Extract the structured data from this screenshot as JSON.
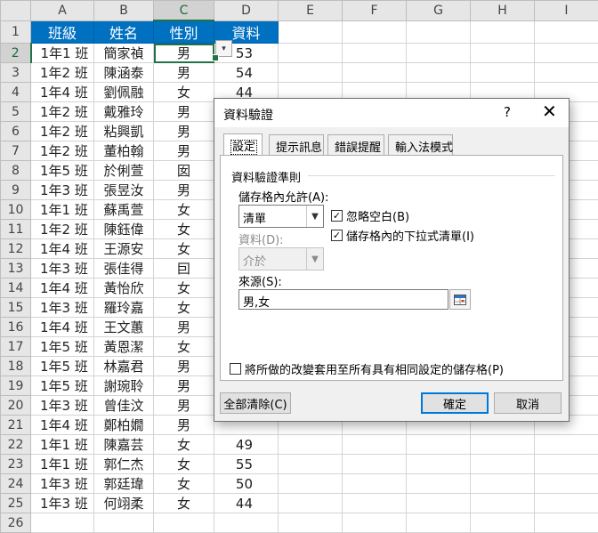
{
  "spreadsheet": {
    "column_headers": [
      "A",
      "B",
      "C",
      "D",
      "E",
      "F",
      "G",
      "H",
      "I"
    ],
    "selected_column": "C",
    "selected_row": 2,
    "header_row": [
      "班級",
      "姓名",
      "性別",
      "資料"
    ],
    "rows": [
      [
        "1年1 班",
        "簡家禎",
        "男",
        "53"
      ],
      [
        "1年2 班",
        "陳涵泰",
        "男",
        "54"
      ],
      [
        "1年4 班",
        "劉佩融",
        "女",
        "44"
      ],
      [
        "1年2 班",
        "戴雅玲",
        "男",
        ""
      ],
      [
        "1年2 班",
        "粘興凱",
        "男",
        ""
      ],
      [
        "1年2 班",
        "董柏翰",
        "男",
        ""
      ],
      [
        "1年5 班",
        "於俐萱",
        "囡",
        ""
      ],
      [
        "1年3 班",
        "張昱汝",
        "男",
        ""
      ],
      [
        "1年1 班",
        "蘇禹萱",
        "女",
        ""
      ],
      [
        "1年2 班",
        "陳鈺偉",
        "女",
        ""
      ],
      [
        "1年4 班",
        "王源安",
        "女",
        ""
      ],
      [
        "1年3 班",
        "張佳得",
        "囙",
        ""
      ],
      [
        "1年4 班",
        "黃怡欣",
        "女",
        ""
      ],
      [
        "1年3 班",
        "羅玲嘉",
        "女",
        ""
      ],
      [
        "1年4 班",
        "王文蕙",
        "男",
        ""
      ],
      [
        "1年5 班",
        "黃恩潔",
        "女",
        ""
      ],
      [
        "1年5 班",
        "林嘉君",
        "男",
        ""
      ],
      [
        "1年5 班",
        "謝琬聆",
        "男",
        ""
      ],
      [
        "1年3 班",
        "曾佳汶",
        "男",
        ""
      ],
      [
        "1年4 班",
        "鄭柏嫺",
        "男",
        ""
      ],
      [
        "1年1 班",
        "陳嘉芸",
        "女",
        "49"
      ],
      [
        "1年1 班",
        "郭仁杰",
        "女",
        "55"
      ],
      [
        "1年3 班",
        "郭廷瑋",
        "女",
        "50"
      ],
      [
        "1年3 班",
        "何翊柔",
        "女",
        "44"
      ]
    ],
    "dropdown_arrow": "▾"
  },
  "dialog": {
    "title": "資料驗證",
    "help": "?",
    "close": "✕",
    "tabs": [
      "設定",
      "提示訊息",
      "錯誤提醒",
      "輸入法模式"
    ],
    "active_tab": 0,
    "group_label": "資料驗證準則",
    "allow_label": "儲存格內允許(A):",
    "allow_value": "清單",
    "data_label": "資料(D):",
    "data_value": "介於",
    "ignore_blank_label": "忽略空白(B)",
    "ignore_blank_checked": true,
    "in_cell_dropdown_label": "儲存格內的下拉式清單(I)",
    "in_cell_dropdown_checked": true,
    "source_label": "來源(S):",
    "source_value": "男,女",
    "apply_all_label": "將所做的改變套用至所有具有相同設定的儲存格(P)",
    "apply_all_checked": false,
    "clear_all_label": "全部清除(C)",
    "ok_label": "確定",
    "cancel_label": "取消",
    "check_mark": "☑"
  }
}
